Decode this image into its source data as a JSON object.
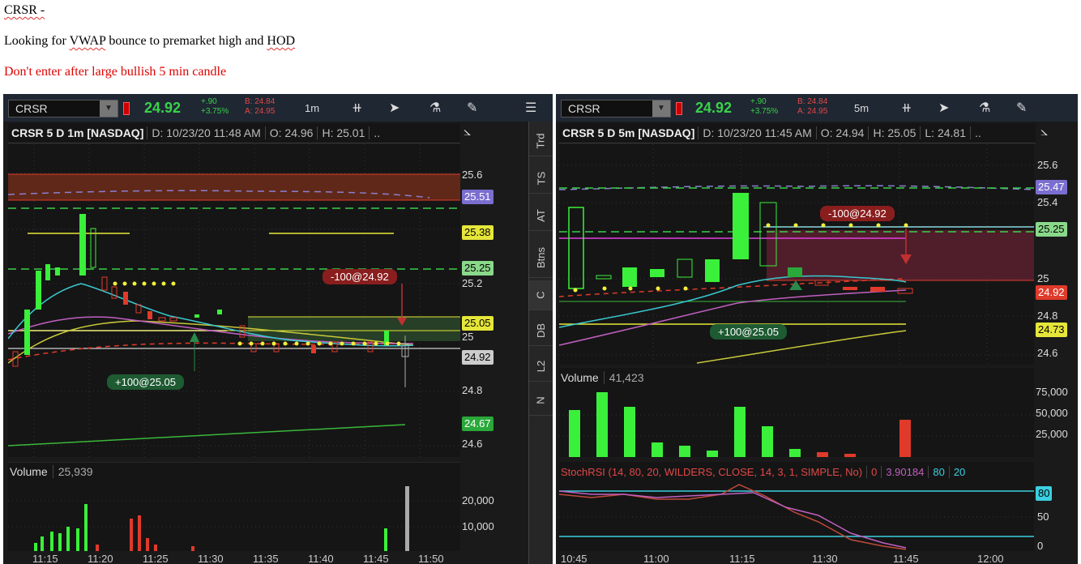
{
  "notes": {
    "line1": "CRSR -",
    "line2_pre": "Looking for ",
    "line2_vwap": "VWAP",
    "line2_mid": " bounce to premarket high and ",
    "line2_hod": "HOD",
    "line3": "Don't enter after large bullish 5 min candle"
  },
  "left": {
    "symbol": "CRSR",
    "last": "24.92",
    "change": "+.90",
    "change_pct": "+3.75%",
    "bid": "B: 24.84",
    "ask": "A: 24.95",
    "aggregation": "1m",
    "header_title": "CRSR 5 D 1m [NASDAQ]",
    "header_date": "D: 10/23/20 11:48 AM",
    "header_open": "O: 24.96",
    "header_high": "H: 25.01",
    "header_more": "..",
    "price_ticks": [
      "25.6",
      "25.2",
      "25",
      "24.8",
      "24.6"
    ],
    "price_tags": {
      "t1": "25.51",
      "t2": "25.38",
      "t3": "25.25",
      "t4": "25.05",
      "t5": "24.92",
      "t6": "24.67"
    },
    "sell_order": "-100@24.92",
    "buy_order": "+100@25.05",
    "volume_label": "Volume",
    "volume_value": "25,939",
    "volume_ticks": [
      "20,000",
      "10,000"
    ],
    "time_ticks": [
      "11:15",
      "11:20",
      "11:25",
      "11:30",
      "11:35",
      "11:40",
      "11:45",
      "11:50"
    ],
    "sidebar": [
      "Trd",
      "TS",
      "AT",
      "Btns",
      "C",
      "DB",
      "L2",
      "N"
    ]
  },
  "right": {
    "symbol": "CRSR",
    "last": "24.92",
    "change": "+.90",
    "change_pct": "+3.75%",
    "bid": "B: 24.84",
    "ask": "A: 24.95",
    "aggregation": "5m",
    "header_title": "CRSR 5 D 5m [NASDAQ]",
    "header_date": "D: 10/23/20 11:45 AM",
    "header_open": "O: 24.94",
    "header_high": "H: 25.05",
    "header_low": "L: 24.81",
    "header_more": "..",
    "price_ticks": [
      "25.6",
      "25.4",
      "25",
      "24.8",
      "24.6"
    ],
    "price_tags": {
      "t1": "25.47",
      "t2": "25.25",
      "t3": "24.92",
      "t4": "24.73"
    },
    "sell_order": "-100@24.92",
    "buy_order": "+100@25.05",
    "volume_label": "Volume",
    "volume_value": "41,423",
    "volume_ticks": [
      "75,000",
      "50,000",
      "25,000"
    ],
    "stoch_label": "StochRSI (14, 80, 20, WILDERS, CLOSE, 14, 3, 1, SIMPLE, No)",
    "stoch_v1": "0",
    "stoch_v2": "3.90184",
    "stoch_v3": "80",
    "stoch_v4": "20",
    "stoch_ticks": [
      "80",
      "50",
      "0"
    ],
    "time_ticks": [
      "10:45",
      "11:00",
      "11:15",
      "11:30",
      "11:45",
      "12:00"
    ]
  }
}
